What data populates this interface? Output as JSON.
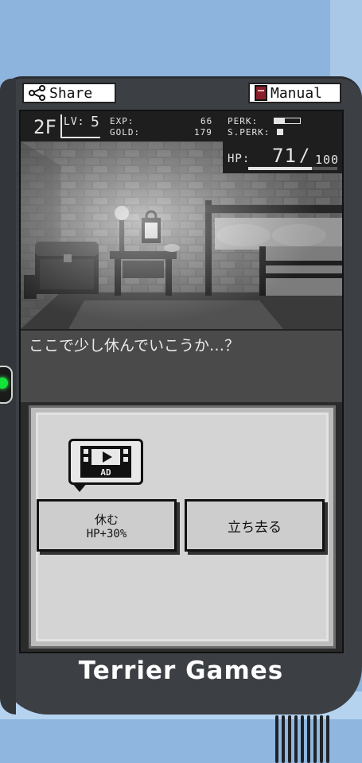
{
  "toolbar": {
    "share_label": "Share",
    "manual_label": "Manual"
  },
  "hud": {
    "floor": "2F",
    "lv_label": "LV:",
    "lv": "5",
    "exp_label": "EXP:",
    "exp": "66",
    "perk_label": "PERK:",
    "gold_label": "GOLD:",
    "gold": "179",
    "sperk_label": "S.PERK:",
    "hp_label": "HP:",
    "hp_current": "71",
    "hp_max": "100",
    "hp_fraction": 0.71,
    "perk_fraction": 0.4,
    "sperk_fraction": 0.0
  },
  "dialog": {
    "text": "ここで少し休んでいこうか…？"
  },
  "choices": {
    "ad_label": "AD",
    "rest_title": "休む",
    "rest_sub": "HP+30%",
    "stand_title": "立ち去る"
  },
  "brand": "Terrier Games",
  "colors": {
    "device_body": "#3c3f44",
    "background": "#8fb6de",
    "led": "#14e33a",
    "panel": "#d4d4d4"
  },
  "icons": {
    "share": "share-icon",
    "manual": "book-icon",
    "ad": "video-ad-icon"
  }
}
